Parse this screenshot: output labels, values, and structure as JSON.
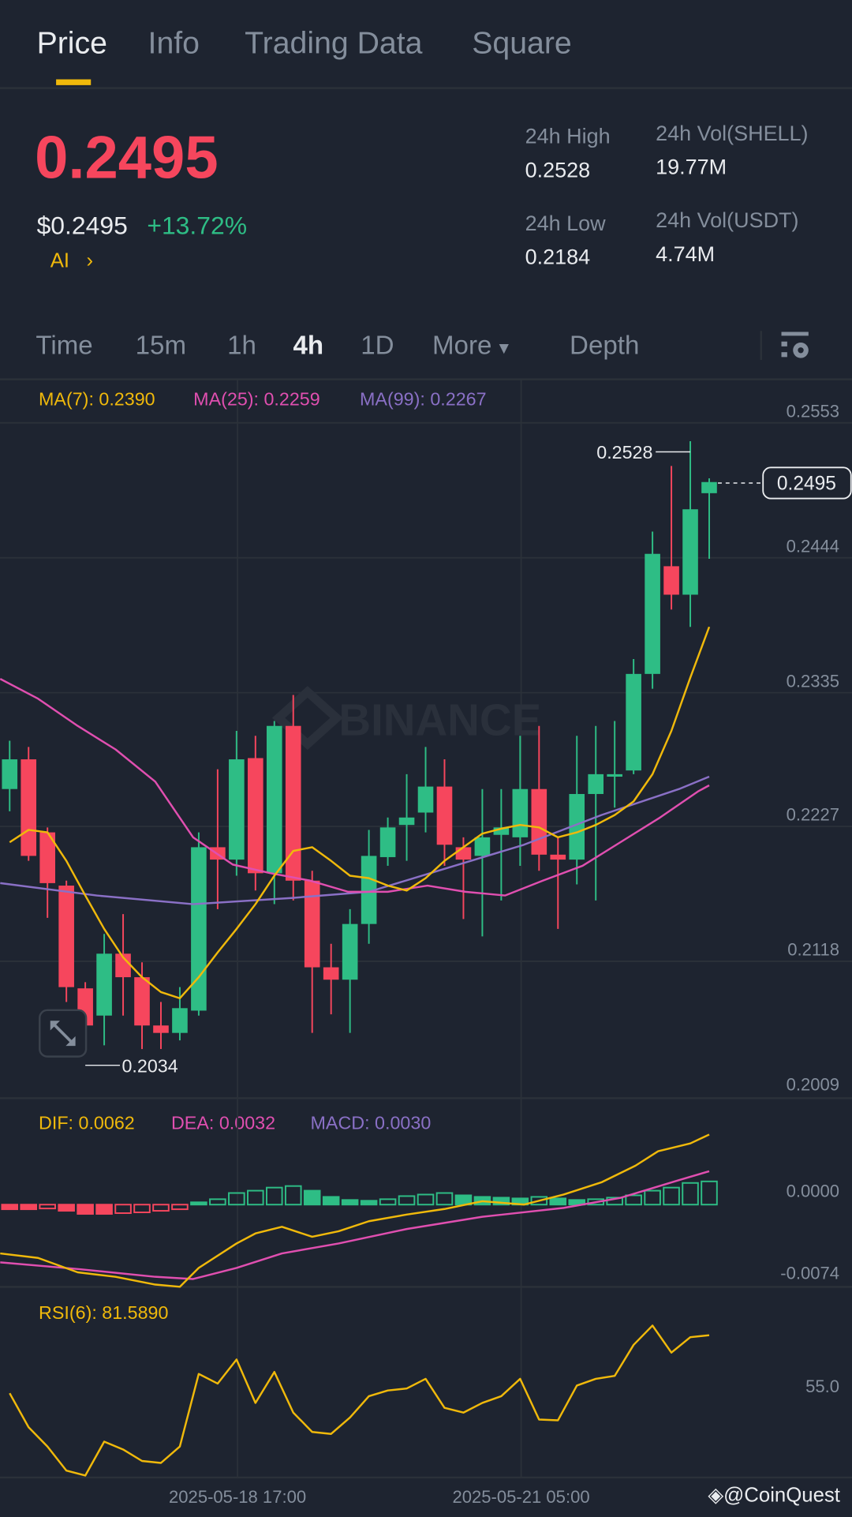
{
  "tabs": [
    {
      "label": "Price",
      "active": true
    },
    {
      "label": "Info"
    },
    {
      "label": "Trading Data"
    },
    {
      "label": "Square"
    }
  ],
  "ticker": {
    "last_price": "0.2495",
    "usd_price": "$0.2495",
    "change": "+13.72%",
    "ai_label": "AI",
    "ai_chevron": "›"
  },
  "stats": {
    "high_label": "24h High",
    "high": "0.2528",
    "low_label": "24h Low",
    "low": "0.2184",
    "vol_base_label": "24h Vol(SHELL)",
    "vol_base": "19.77M",
    "vol_quote_label": "24h Vol(USDT)",
    "vol_quote": "4.74M"
  },
  "intervals": [
    {
      "label": "Time"
    },
    {
      "label": "15m"
    },
    {
      "label": "1h"
    },
    {
      "label": "4h",
      "active": true
    },
    {
      "label": "1D"
    },
    {
      "label": "More",
      "caret": "▾"
    },
    {
      "label": "Depth"
    }
  ],
  "colors": {
    "up": "#2ebd85",
    "down": "#f6465d",
    "ma7": "#f0b90b",
    "ma25": "#e04fb0",
    "ma99": "#8a70c6",
    "accent": "#f0b90b"
  },
  "chart_data": [
    {
      "type": "candlestick",
      "title": "4h candles",
      "legend": {
        "ma7": "MA(7): 0.2390",
        "ma25": "MA(25): 0.2259",
        "ma99": "MA(99): 0.2267"
      },
      "y_ticks": [
        "0.2553",
        "0.2444",
        "0.2335",
        "0.2227",
        "0.2118",
        "0.2009"
      ],
      "ylim": [
        0.2009,
        0.2553
      ],
      "x_ticks": [
        "2025-05-18 17:00",
        "2025-05-21 05:00"
      ],
      "x_tick_index": [
        12,
        27
      ],
      "high_annotation": "0.2528",
      "low_annotation": "0.2034",
      "last_price_tag": "0.2495",
      "watermark": "BINANCE",
      "ohlc": [
        [
          0.2247,
          0.2286,
          0.2229,
          0.2271
        ],
        [
          0.2271,
          0.2281,
          0.2189,
          0.2193
        ],
        [
          0.2212,
          0.2216,
          0.2143,
          0.2171
        ],
        [
          0.2169,
          0.2173,
          0.2075,
          0.2087
        ],
        [
          0.2086,
          0.2091,
          0.2034,
          0.2056
        ],
        [
          0.2064,
          0.213,
          0.204,
          0.2114
        ],
        [
          0.2114,
          0.2146,
          0.2064,
          0.2095
        ],
        [
          0.2095,
          0.2107,
          0.2037,
          0.2056
        ],
        [
          0.2056,
          0.2075,
          0.2037,
          0.205
        ],
        [
          0.205,
          0.2087,
          0.2044,
          0.207
        ],
        [
          0.2068,
          0.2212,
          0.2064,
          0.22
        ],
        [
          0.22,
          0.2263,
          0.215,
          0.219
        ],
        [
          0.219,
          0.2294,
          0.2177,
          0.2271
        ],
        [
          0.2272,
          0.229,
          0.2165,
          0.2179
        ],
        [
          0.2179,
          0.2302,
          0.2154,
          0.2298
        ],
        [
          0.2298,
          0.2323,
          0.2157,
          0.2173
        ],
        [
          0.2173,
          0.2181,
          0.205,
          0.2103
        ],
        [
          0.2103,
          0.2122,
          0.2065,
          0.2093
        ],
        [
          0.2093,
          0.215,
          0.205,
          0.2138
        ],
        [
          0.2138,
          0.2214,
          0.2122,
          0.2193
        ],
        [
          0.2192,
          0.2224,
          0.2185,
          0.2216
        ],
        [
          0.2218,
          0.2259,
          0.2189,
          0.2224
        ],
        [
          0.2228,
          0.2281,
          0.2212,
          0.2249
        ],
        [
          0.2249,
          0.2271,
          0.2185,
          0.2202
        ],
        [
          0.22,
          0.2208,
          0.2142,
          0.219
        ],
        [
          0.2193,
          0.2247,
          0.2128,
          0.2208
        ],
        [
          0.221,
          0.2247,
          0.2157,
          0.2216
        ],
        [
          0.2208,
          0.229,
          0.2185,
          0.2247
        ],
        [
          0.2247,
          0.2298,
          0.2181,
          0.2194
        ],
        [
          0.2194,
          0.2208,
          0.2134,
          0.219
        ],
        [
          0.219,
          0.229,
          0.217,
          0.2243
        ],
        [
          0.2243,
          0.2298,
          0.2157,
          0.2259
        ],
        [
          0.2257,
          0.2302,
          0.2232,
          0.2259
        ],
        [
          0.2262,
          0.2352,
          0.2259,
          0.234
        ],
        [
          0.234,
          0.2455,
          0.2328,
          0.2437
        ],
        [
          0.2427,
          0.2508,
          0.2392,
          0.2404
        ],
        [
          0.2404,
          0.2528,
          0.2378,
          0.2473
        ],
        [
          0.2486,
          0.2498,
          0.2433,
          0.2495
        ]
      ],
      "ma7": [
        0.2204,
        0.2214,
        0.2212,
        0.2189,
        0.2161,
        0.2134,
        0.2111,
        0.2095,
        0.2083,
        0.2078,
        0.2095,
        0.2115,
        0.2134,
        0.2154,
        0.2177,
        0.2197,
        0.22,
        0.2189,
        0.2177,
        0.2175,
        0.2169,
        0.2165,
        0.2175,
        0.2189,
        0.22,
        0.2211,
        0.2215,
        0.2218,
        0.2216,
        0.2208,
        0.2212,
        0.2218,
        0.2226,
        0.2237,
        0.2259,
        0.2294,
        0.2337,
        0.2378
      ],
      "ma25_points": [
        [
          -0.5,
          0.2336
        ],
        [
          1.5,
          0.232
        ],
        [
          3.6,
          0.2298
        ],
        [
          5.6,
          0.2279
        ],
        [
          7.7,
          0.2253
        ],
        [
          9.7,
          0.2208
        ],
        [
          11.8,
          0.2186
        ],
        [
          13.8,
          0.2179
        ],
        [
          15.9,
          0.2173
        ],
        [
          17.9,
          0.2164
        ],
        [
          20,
          0.2164
        ],
        [
          22.1,
          0.2169
        ],
        [
          24.1,
          0.2164
        ],
        [
          26.2,
          0.2161
        ],
        [
          28.2,
          0.2173
        ],
        [
          30.3,
          0.2185
        ],
        [
          32.3,
          0.2204
        ],
        [
          34.4,
          0.2224
        ],
        [
          36.4,
          0.2245
        ],
        [
          37,
          0.225
        ]
      ],
      "ma99_points": [
        [
          -0.5,
          0.2171
        ],
        [
          4.6,
          0.2161
        ],
        [
          9.7,
          0.2154
        ],
        [
          14.9,
          0.2159
        ],
        [
          19,
          0.2164
        ],
        [
          23.1,
          0.2183
        ],
        [
          27.2,
          0.2202
        ],
        [
          31.3,
          0.2226
        ],
        [
          35.4,
          0.2247
        ],
        [
          37,
          0.2257
        ]
      ]
    },
    {
      "type": "line",
      "title": "MACD",
      "legend": {
        "dif": "DIF: 0.0062",
        "dea": "DEA: 0.0032",
        "macd": "MACD: 0.0030"
      },
      "y_ticks": [
        "0.0000",
        "-0.0074"
      ],
      "dif_points": [
        [
          -0.5,
          -0.0057
        ],
        [
          1.5,
          -0.0061
        ],
        [
          3.6,
          -0.0074
        ],
        [
          5.6,
          -0.0078
        ],
        [
          7.7,
          -0.0085
        ],
        [
          9,
          -0.0087
        ],
        [
          10,
          -0.007
        ],
        [
          12,
          -0.0048
        ],
        [
          13,
          -0.0039
        ],
        [
          14.4,
          -0.0033
        ],
        [
          16,
          -0.0042
        ],
        [
          17.4,
          -0.0037
        ],
        [
          19,
          -0.0028
        ],
        [
          21,
          -0.0022
        ],
        [
          23,
          -0.0017
        ],
        [
          25,
          -0.001
        ],
        [
          27.2,
          -0.0013
        ],
        [
          29.3,
          -0.0004
        ],
        [
          31.3,
          0.0007
        ],
        [
          33.1,
          0.0022
        ],
        [
          34.3,
          0.0035
        ],
        [
          36,
          0.0042
        ],
        [
          37,
          0.005
        ]
      ],
      "dea_points": [
        [
          -0.5,
          -0.0065
        ],
        [
          3.6,
          -0.0071
        ],
        [
          7.7,
          -0.0078
        ],
        [
          9.7,
          -0.008
        ],
        [
          12,
          -0.007
        ],
        [
          14.4,
          -0.0057
        ],
        [
          17.4,
          -0.0048
        ],
        [
          21,
          -0.0035
        ],
        [
          25,
          -0.0024
        ],
        [
          29.3,
          -0.0016
        ],
        [
          32.3,
          -0.0007
        ],
        [
          35.4,
          0.0009
        ],
        [
          37,
          0.0017
        ]
      ],
      "histogram": [
        -0.0006,
        -0.0006,
        -0.0005,
        -0.0008,
        -0.0012,
        -0.0012,
        -0.0011,
        -0.001,
        -0.0008,
        -0.0006,
        0.0003,
        0.0007,
        0.0015,
        0.0018,
        0.0022,
        0.0024,
        0.0018,
        0.001,
        0.0006,
        0.0005,
        0.0007,
        0.0011,
        0.0013,
        0.0015,
        0.0012,
        0.001,
        0.0009,
        0.0008,
        0.001,
        0.0008,
        0.0006,
        0.0007,
        0.0009,
        0.0012,
        0.0018,
        0.0022,
        0.0028,
        0.003
      ]
    },
    {
      "type": "line",
      "title": "RSI",
      "legend": "RSI(6): 81.5890",
      "y_ticks": [
        "55.0"
      ],
      "ylim": [
        9.4,
        100
      ],
      "values": [
        51.1,
        33.9,
        24.1,
        11.9,
        9.4,
        26.6,
        22.6,
        16.8,
        15.8,
        24.1,
        60.9,
        56.0,
        68.2,
        46.2,
        61.9,
        41.3,
        31.5,
        30.5,
        38.8,
        49.6,
        52.5,
        53.5,
        58.4,
        43.7,
        41.3,
        46.2,
        49.6,
        58.4,
        37.8,
        37.4,
        55.0,
        58.4,
        59.9,
        75.6,
        85.4,
        71.7,
        79.5,
        80.5
      ]
    }
  ],
  "footer": {
    "watermark": "@CoinQuest"
  }
}
